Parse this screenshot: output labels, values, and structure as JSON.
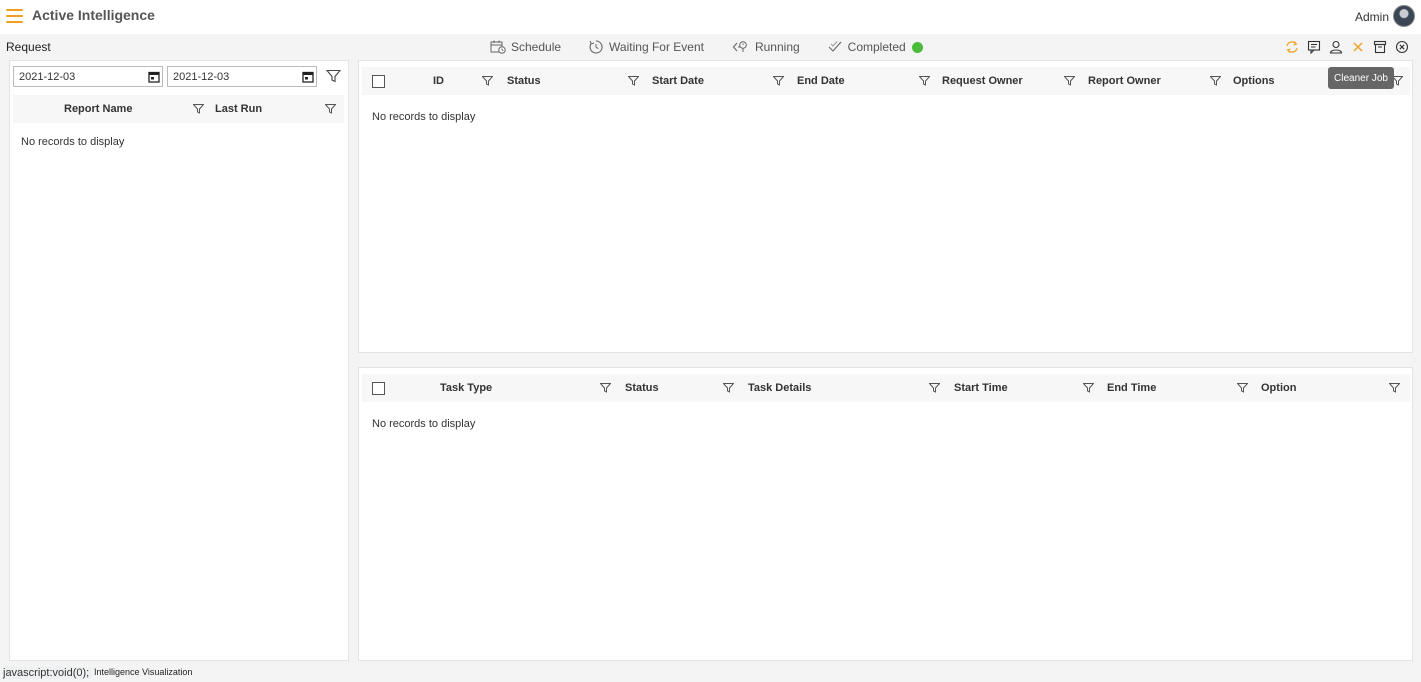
{
  "app": {
    "title": "Active Intelligence",
    "user": "Admin"
  },
  "section_title": "Request",
  "tabs": [
    {
      "label": "Schedule",
      "icon": "calendar-clock-icon"
    },
    {
      "label": "Waiting For Event",
      "icon": "clock-icon"
    },
    {
      "label": "Running",
      "icon": "running-icon"
    },
    {
      "label": "Completed",
      "icon": "check-icon",
      "status_color": "#4cbb3c"
    }
  ],
  "tools": [
    {
      "name": "refresh-icon",
      "color": "#f0a020"
    },
    {
      "name": "message-icon",
      "color": "#333333"
    },
    {
      "name": "user-icon",
      "color": "#333333"
    },
    {
      "name": "close-icon",
      "color": "#f0a020"
    },
    {
      "name": "archive-icon",
      "color": "#333333"
    },
    {
      "name": "circle-close-icon",
      "color": "#333333"
    }
  ],
  "tooltip": "Cleaner Job",
  "left_panel": {
    "date_from": "2021-12-03",
    "date_to": "2021-12-03",
    "columns": [
      "Report Name",
      "Last Run"
    ],
    "empty": "No records to display"
  },
  "request_grid": {
    "columns": [
      "ID",
      "Status",
      "Start Date",
      "End Date",
      "Request Owner",
      "Report Owner",
      "Options"
    ],
    "empty": "No records to display"
  },
  "task_grid": {
    "columns": [
      "Task Type",
      "Status",
      "Task Details",
      "Start Time",
      "End Time",
      "Option"
    ],
    "empty": "No records to display"
  },
  "statusbar": {
    "url": "javascript:void(0);",
    "app": "Intelligence Visualization"
  },
  "colors": {
    "accent": "#f0a020",
    "completed": "#4cbb3c"
  }
}
